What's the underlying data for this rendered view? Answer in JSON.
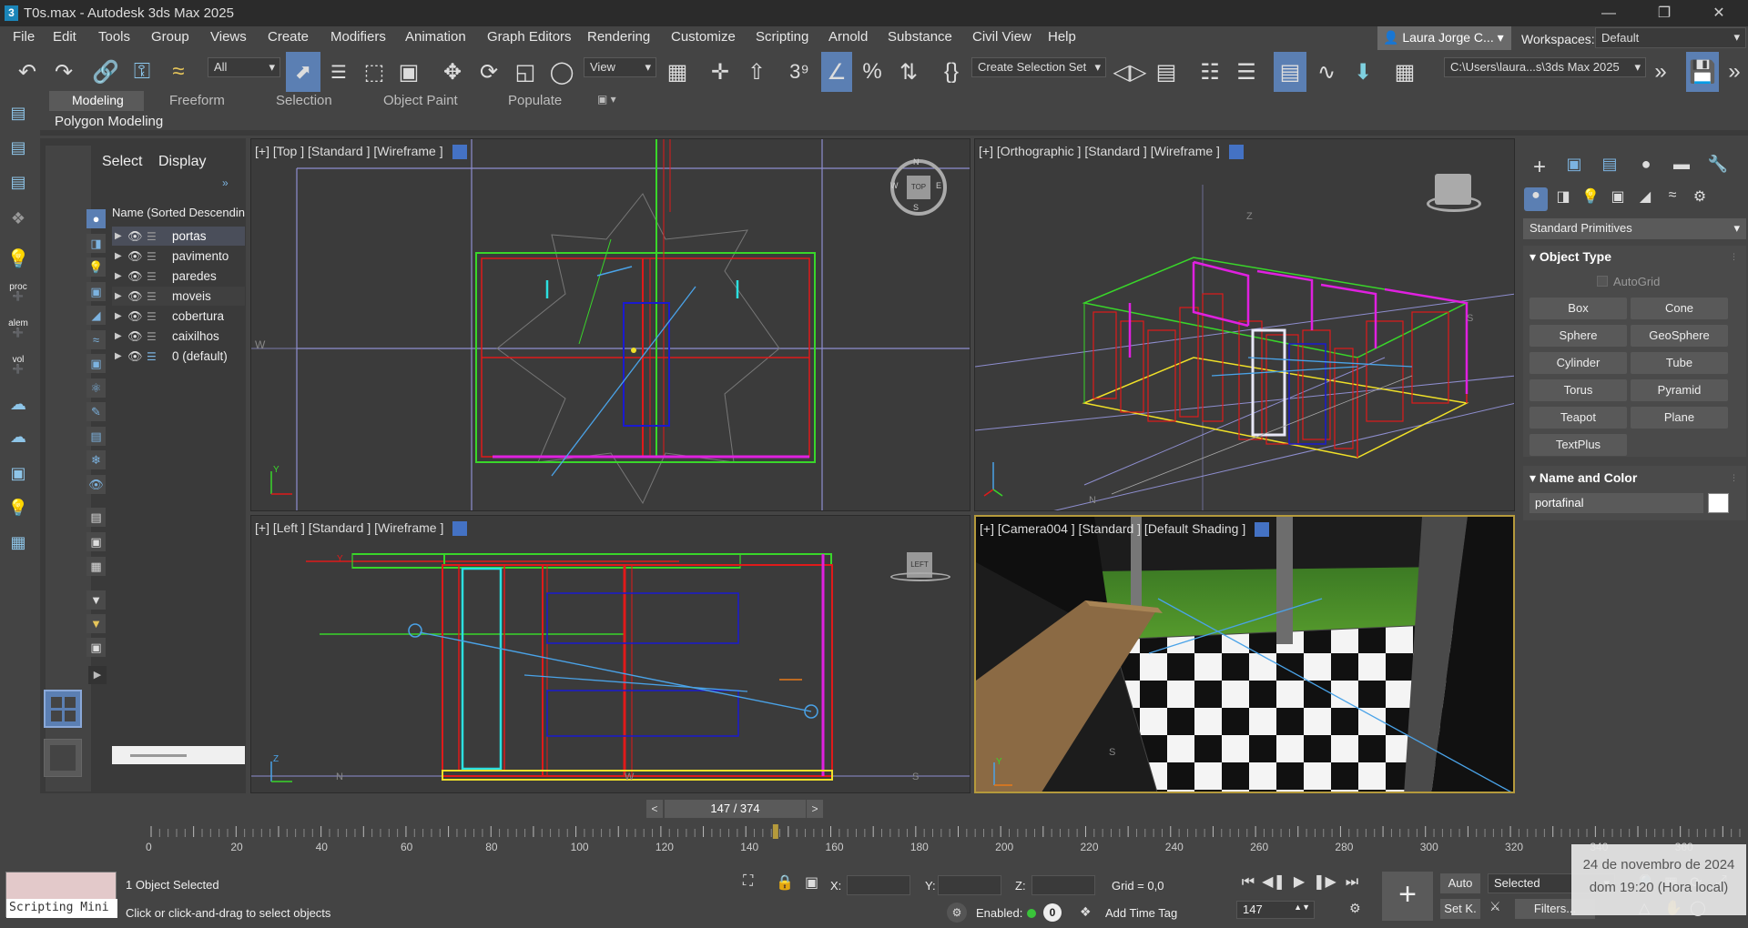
{
  "window": {
    "title": "T0s.max - Autodesk 3ds Max 2025",
    "app_icon": "3"
  },
  "menu": [
    "File",
    "Edit",
    "Tools",
    "Group",
    "Views",
    "Create",
    "Modifiers",
    "Animation",
    "Graph Editors",
    "Rendering",
    "Customize",
    "Scripting",
    "Arnold",
    "Substance",
    "Civil View",
    "Help"
  ],
  "user": {
    "name": "Laura Jorge C...",
    "workspaces_label": "Workspaces:",
    "workspace": "Default"
  },
  "toolbar": {
    "filter": "All",
    "ref_coord": "View",
    "selection_set": "Create Selection Set",
    "project_path": "C:\\Users\\laura...s\\3ds Max 2025"
  },
  "ribbon": {
    "tabs": [
      "Modeling",
      "Freeform",
      "Selection",
      "Object Paint",
      "Populate"
    ],
    "active": "Modeling",
    "panel": "Polygon Modeling"
  },
  "left_tools": {
    "proc": "proc",
    "alem": "alem",
    "vol": "vol"
  },
  "scene_explorer": {
    "tabs": [
      "Select",
      "Display"
    ],
    "header": "Name (Sorted Descendin",
    "layers": [
      "portas",
      "pavimento",
      "paredes",
      "moveis",
      "cobertura",
      "caixilhos",
      "0 (default)"
    ],
    "selected_layer": "portas"
  },
  "viewports": {
    "top": {
      "label": "[+] [Top ] [Standard ] [Wireframe ]",
      "cube": "TOP",
      "compass": {
        "n": "N",
        "s": "S",
        "e": "E",
        "w": "W"
      },
      "side_letter": "W",
      "axis_y": "Y"
    },
    "ortho": {
      "label": "[+] [Orthographic ] [Standard ] [Wireframe ]",
      "z": "Z",
      "s": "S",
      "n": "N"
    },
    "left": {
      "label": "[+] [Left ] [Standard ] [Wireframe ]",
      "cube": "LEFT",
      "n": "N",
      "s": "S",
      "w": "W",
      "y": "Y",
      "z": "Z"
    },
    "camera": {
      "label": "[+] [Camera004 ] [Standard ] [Default Shading ]",
      "s": "S",
      "y": "Y"
    }
  },
  "timeline": {
    "frame_display": "147 / 374",
    "current_frame": 147,
    "total_frames": 374,
    "ticks": [
      0,
      20,
      40,
      60,
      80,
      100,
      120,
      140,
      160,
      180,
      200,
      220,
      240,
      260,
      280,
      300,
      320,
      340,
      360
    ]
  },
  "status": {
    "script_label": "Scripting Mini",
    "selection": "1 Object Selected",
    "prompt": "Click or click-and-drag to select objects",
    "x_label": "X:",
    "y_label": "Y:",
    "z_label": "Z:",
    "grid": "Grid = 0,0",
    "enabled": "Enabled:",
    "time_tag": "Add Time Tag",
    "auto": "Auto",
    "set_k": "Set K.",
    "key_mode": "Selected",
    "frame_spinner": "147",
    "filters": "Filters...",
    "enabled_count": "0"
  },
  "command_panel": {
    "category": "Standard Primitives",
    "object_type_header": "Object Type",
    "autogrid": "AutoGrid",
    "buttons": [
      "Box",
      "Cone",
      "Sphere",
      "GeoSphere",
      "Cylinder",
      "Tube",
      "Torus",
      "Pyramid",
      "Teapot",
      "Plane",
      "TextPlus"
    ],
    "name_color_header": "Name and Color",
    "object_name": "portafinal",
    "object_color": "#ffffff"
  },
  "tooltip": {
    "date": "24 de novembro de 2024",
    "time": "dom 19:20 (Hora local)"
  },
  "colors": {
    "accent": "#5b7fb3",
    "viewport_bg": "#3b3b3b",
    "camera_border": "#b59a3c"
  }
}
